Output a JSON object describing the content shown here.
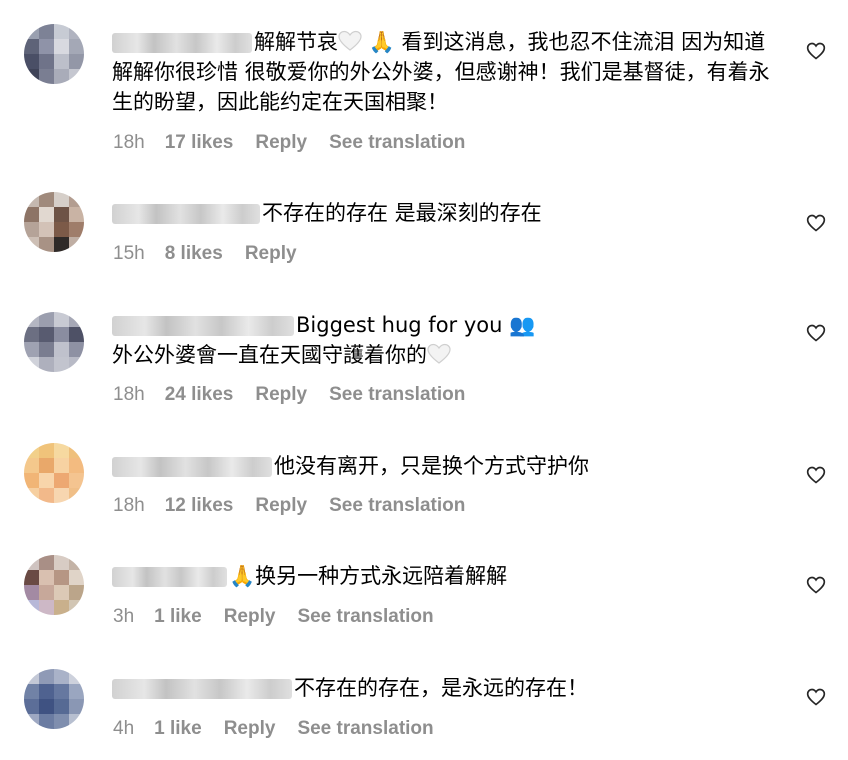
{
  "comments": [
    {
      "text_pre": "解解节哀",
      "emoji_1": "♡",
      "emoji_2": "🙏",
      "text": "看到这消息，我也忍不住流泪 因为知道解解你很珍惜 很敬爱你的外公外婆，但感谢神！我们是基督徒，有着永生的盼望，因此能约定在天国相聚！",
      "time": "18h",
      "likes": "17 likes",
      "reply": "Reply",
      "translate": "See translation"
    },
    {
      "text": "不存在的存在 是最深刻的存在",
      "time": "15h",
      "likes": "8 likes",
      "reply": "Reply"
    },
    {
      "text_line1": "Biggest hug for you",
      "emoji_people": "👥",
      "text_line2": "外公外婆會一直在天國守護着你的",
      "emoji_heart": "♡",
      "time": "18h",
      "likes": "24 likes",
      "reply": "Reply",
      "translate": "See translation"
    },
    {
      "text": "他没有离开，只是换个方式守护你",
      "time": "18h",
      "likes": "12 likes",
      "reply": "Reply",
      "translate": "See translation"
    },
    {
      "emoji": "🙏",
      "text": "换另一种方式永远陪着解解",
      "time": "3h",
      "likes": "1 like",
      "reply": "Reply",
      "translate": "See translation"
    },
    {
      "text": "不存在的存在，是永远的存在！",
      "time": "4h",
      "likes": "1 like",
      "reply": "Reply",
      "translate": "See translation"
    }
  ],
  "icons": {
    "like": "heart-outline-icon"
  },
  "colors": {
    "text": "#000000",
    "meta": "#8e8e8e",
    "background": "#ffffff"
  }
}
